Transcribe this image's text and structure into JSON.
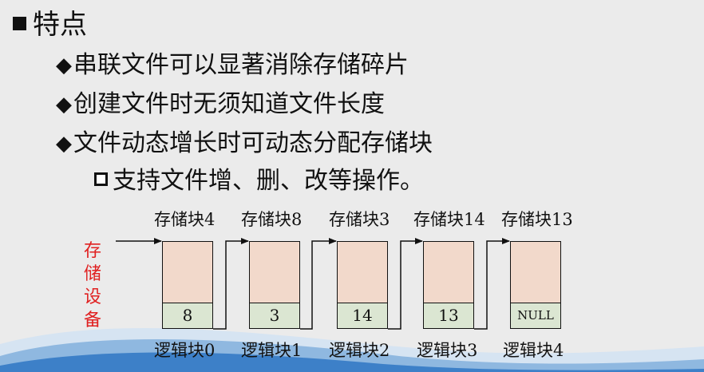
{
  "heading": "特点",
  "bullets": [
    "串联文件可以显著消除存储碎片",
    "创建文件时无须知道文件长度",
    "文件动态增长时可动态分配存储块"
  ],
  "sub_bullet": "支持文件增、删、改等操作。",
  "storage_label": [
    "存",
    "储",
    "设",
    "备"
  ],
  "blocks": [
    {
      "storage": "存储块4",
      "pointer": "8",
      "logical": "逻辑块0"
    },
    {
      "storage": "存储块8",
      "pointer": "3",
      "logical": "逻辑块1"
    },
    {
      "storage": "存储块3",
      "pointer": "14",
      "logical": "逻辑块2"
    },
    {
      "storage": "存储块14",
      "pointer": "13",
      "logical": "逻辑块3"
    },
    {
      "storage": "存储块13",
      "pointer": "NULL",
      "logical": "逻辑块4"
    }
  ],
  "colors": {
    "block_fill": "#f2d9cb",
    "pointer_fill": "#dbe6d2",
    "storage_label": "#e02020",
    "background": "#ebebeb"
  }
}
